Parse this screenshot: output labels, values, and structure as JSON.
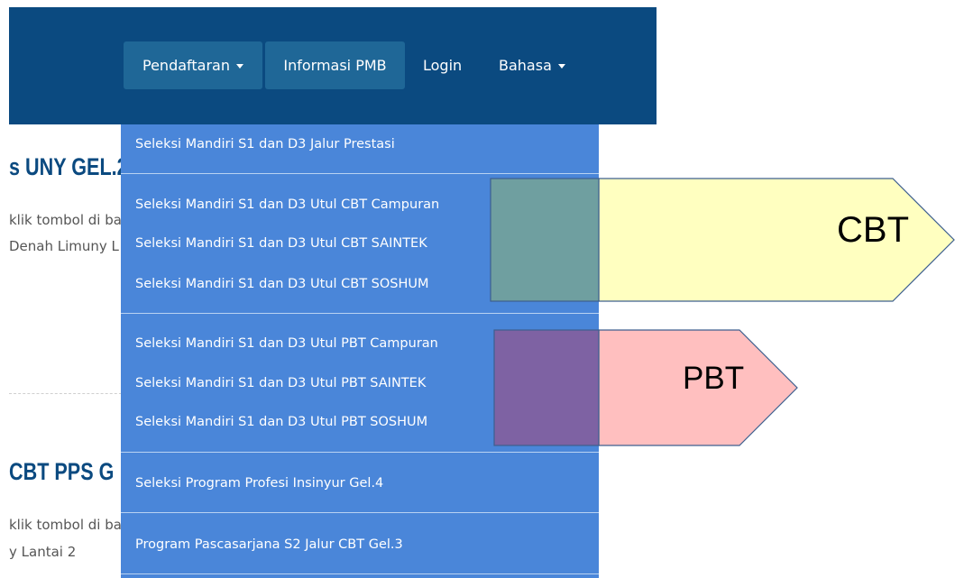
{
  "navbar": {
    "items": [
      {
        "label": "Pendaftaran",
        "has_caret": true,
        "active": true
      },
      {
        "label": "Informasi PMB",
        "has_caret": false,
        "active": true
      },
      {
        "label": "Login",
        "has_caret": false,
        "active": false
      },
      {
        "label": "Bahasa",
        "has_caret": true,
        "active": false
      }
    ]
  },
  "background": {
    "heading_1": "s UNY GEL.2",
    "text_1a": "klik tombol di ba",
    "text_1b": "Denah Limuny L",
    "heading_2": "CBT PPS G",
    "text_2a": "klik tombol di ba",
    "text_2b": "y Lantai 2"
  },
  "dropdown": {
    "items": [
      "Seleksi Mandiri S1 dan D3 Jalur Prestasi",
      "Seleksi Mandiri S1 dan D3 Utul CBT Campuran",
      "Seleksi Mandiri S1 dan D3 Utul CBT SAINTEK",
      "Seleksi Mandiri S1 dan D3 Utul CBT SOSHUM",
      "Seleksi Mandiri S1 dan D3 Utul PBT Campuran",
      "Seleksi Mandiri S1 dan D3 Utul PBT SAINTEK",
      "Seleksi Mandiri S1 dan D3 Utul PBT SOSHUM",
      "Seleksi Program Profesi Insinyur Gel.4",
      "Program Pascasarjana S2 Jalur CBT Gel.3"
    ]
  },
  "annotations": {
    "cbt_label": "CBT",
    "pbt_label": "PBT",
    "cbt_fill": "#ffffc0",
    "pbt_fill": "#ffbfbf",
    "cbt_overlay": "#6f9fa0",
    "pbt_overlay": "#7e62a3",
    "outline": "#3d5f8f"
  },
  "colors": {
    "navbar": "#0b4a80",
    "nav_active": "#1f6797",
    "dropdown": "#4a86d9",
    "heading": "#0b4a80"
  }
}
